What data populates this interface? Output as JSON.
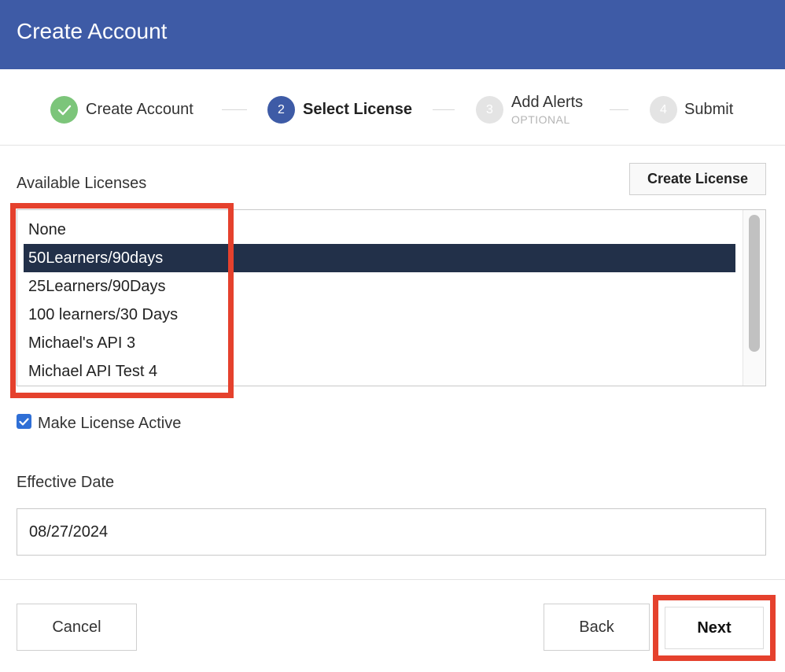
{
  "header": {
    "title": "Create Account"
  },
  "stepper": {
    "steps": [
      {
        "number": "",
        "label": "Create Account",
        "sub": "",
        "state": "complete"
      },
      {
        "number": "2",
        "label": "Select License",
        "sub": "",
        "state": "active"
      },
      {
        "number": "3",
        "label": "Add Alerts",
        "sub": "OPTIONAL",
        "state": "pending"
      },
      {
        "number": "4",
        "label": "Submit",
        "sub": "",
        "state": "pending"
      }
    ],
    "colors": {
      "complete": "#7cc57a",
      "active": "#3e5ba6",
      "pending": "#e4e4e4"
    }
  },
  "licenses": {
    "label": "Available Licenses",
    "create_button": "Create License",
    "items": [
      "None",
      "50Learners/90days",
      "25Learners/90Days",
      "100 learners/30 Days",
      "Michael's API 3",
      "Michael API Test 4"
    ],
    "selected": "50Learners/90days"
  },
  "make_active": {
    "label": "Make License Active",
    "checked": true
  },
  "effective_date": {
    "label": "Effective Date",
    "value": "08/27/2024"
  },
  "footer": {
    "cancel": "Cancel",
    "back": "Back",
    "next": "Next"
  },
  "colors": {
    "header": "#3e5ba6",
    "highlight": "#e5412d",
    "selected_row": "#223049",
    "checkbox": "#2f6fd6"
  }
}
